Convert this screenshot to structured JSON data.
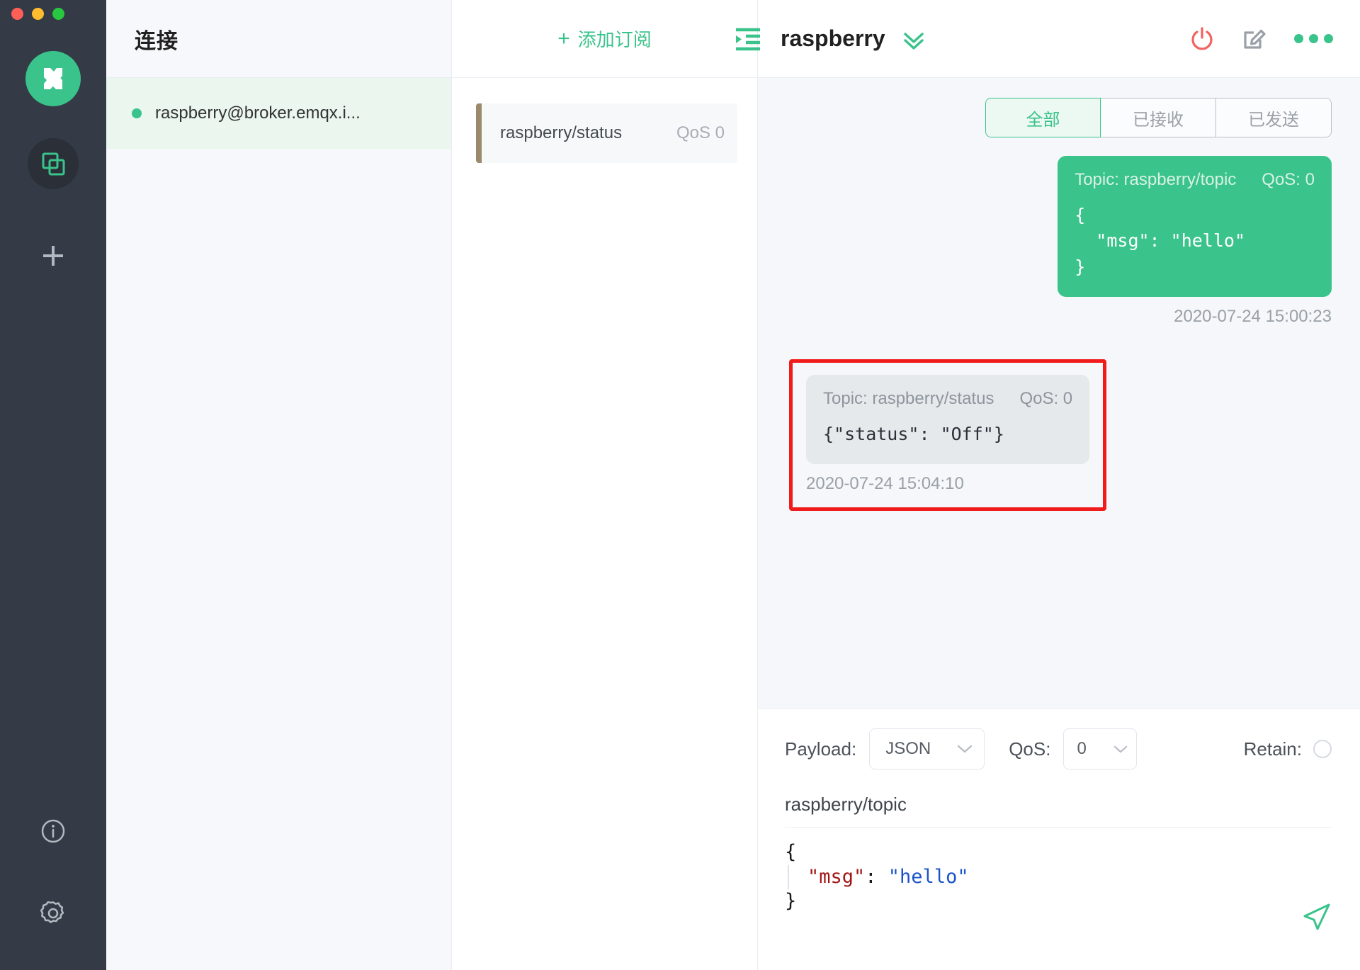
{
  "window": {
    "traffic_lights": [
      "close",
      "minimize",
      "zoom"
    ],
    "colors": {
      "close": "#ff5f57",
      "minimize": "#febc2e",
      "zoom": "#28c840"
    }
  },
  "rail": {
    "logo_name": "mqttx-logo",
    "items": [
      {
        "name": "connections-rail-button",
        "icon": "stacked-squares-icon",
        "active": true
      },
      {
        "name": "new-connection-rail-button",
        "icon": "plus-icon",
        "active": false
      }
    ],
    "bottom_items": [
      {
        "name": "about-rail-button",
        "icon": "info-circle-icon"
      },
      {
        "name": "settings-rail-button",
        "icon": "gear-icon"
      }
    ]
  },
  "connections": {
    "title": "连接",
    "items": [
      {
        "name": "raspberry@broker.emqx.i...",
        "status": "connected"
      }
    ]
  },
  "subscriptions": {
    "add_label": "添加订阅",
    "plus_glyph": "+",
    "collapse_icon": "collapse-left-icon",
    "items": [
      {
        "topic": "raspberry/status",
        "qos": "QoS 0",
        "color": "#9a8a6b"
      }
    ]
  },
  "main": {
    "title": "raspberry",
    "chevron_icon": "double-chevron-down-icon",
    "actions": [
      {
        "name": "disconnect-button",
        "icon": "power-icon",
        "color": "#f2635f"
      },
      {
        "name": "edit-connection-button",
        "icon": "edit-square-icon",
        "color": "#9aa0a8"
      },
      {
        "name": "more-menu-button",
        "icon": "three-dots-icon",
        "color": "#3ac38b"
      }
    ],
    "tabs": [
      {
        "label": "全部",
        "active": true
      },
      {
        "label": "已接收",
        "active": false
      },
      {
        "label": "已发送",
        "active": false
      }
    ],
    "messages": [
      {
        "direction": "sent",
        "topic_label": "Topic: raspberry/topic",
        "qos_label": "QoS: 0",
        "body": "{\n  \"msg\": \"hello\"\n}",
        "time": "2020-07-24 15:00:23",
        "highlighted": false
      },
      {
        "direction": "received",
        "topic_label": "Topic: raspberry/status",
        "qos_label": "QoS: 0",
        "body": "{\"status\": \"Off\"}",
        "time": "2020-07-24 15:04:10",
        "highlighted": true,
        "highlight_color": "#f01b1b"
      }
    ]
  },
  "publish": {
    "payload_label": "Payload:",
    "payload_value": "JSON",
    "qos_label": "QoS:",
    "qos_value": "0",
    "retain_label": "Retain:",
    "retain_checked": false,
    "topic_value": "raspberry/topic",
    "editor": {
      "line1": "{",
      "line2_key": "\"msg\"",
      "line2_colon": ": ",
      "line2_value": "\"hello\"",
      "line3": "}"
    },
    "send_icon": "send-arrow-icon"
  }
}
